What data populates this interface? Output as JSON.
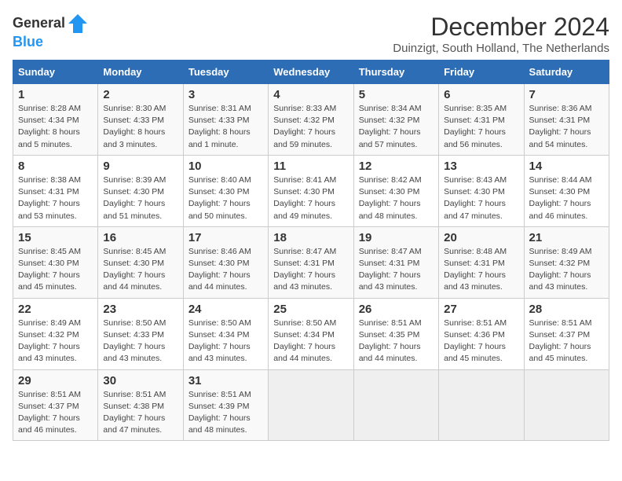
{
  "header": {
    "logo_general": "General",
    "logo_blue": "Blue",
    "main_title": "December 2024",
    "subtitle": "Duinzigt, South Holland, The Netherlands"
  },
  "days_of_week": [
    "Sunday",
    "Monday",
    "Tuesday",
    "Wednesday",
    "Thursday",
    "Friday",
    "Saturday"
  ],
  "weeks": [
    [
      {
        "day": "1",
        "sunrise": "Sunrise: 8:28 AM",
        "sunset": "Sunset: 4:34 PM",
        "daylight": "Daylight: 8 hours and 5 minutes."
      },
      {
        "day": "2",
        "sunrise": "Sunrise: 8:30 AM",
        "sunset": "Sunset: 4:33 PM",
        "daylight": "Daylight: 8 hours and 3 minutes."
      },
      {
        "day": "3",
        "sunrise": "Sunrise: 8:31 AM",
        "sunset": "Sunset: 4:33 PM",
        "daylight": "Daylight: 8 hours and 1 minute."
      },
      {
        "day": "4",
        "sunrise": "Sunrise: 8:33 AM",
        "sunset": "Sunset: 4:32 PM",
        "daylight": "Daylight: 7 hours and 59 minutes."
      },
      {
        "day": "5",
        "sunrise": "Sunrise: 8:34 AM",
        "sunset": "Sunset: 4:32 PM",
        "daylight": "Daylight: 7 hours and 57 minutes."
      },
      {
        "day": "6",
        "sunrise": "Sunrise: 8:35 AM",
        "sunset": "Sunset: 4:31 PM",
        "daylight": "Daylight: 7 hours and 56 minutes."
      },
      {
        "day": "7",
        "sunrise": "Sunrise: 8:36 AM",
        "sunset": "Sunset: 4:31 PM",
        "daylight": "Daylight: 7 hours and 54 minutes."
      }
    ],
    [
      {
        "day": "8",
        "sunrise": "Sunrise: 8:38 AM",
        "sunset": "Sunset: 4:31 PM",
        "daylight": "Daylight: 7 hours and 53 minutes."
      },
      {
        "day": "9",
        "sunrise": "Sunrise: 8:39 AM",
        "sunset": "Sunset: 4:30 PM",
        "daylight": "Daylight: 7 hours and 51 minutes."
      },
      {
        "day": "10",
        "sunrise": "Sunrise: 8:40 AM",
        "sunset": "Sunset: 4:30 PM",
        "daylight": "Daylight: 7 hours and 50 minutes."
      },
      {
        "day": "11",
        "sunrise": "Sunrise: 8:41 AM",
        "sunset": "Sunset: 4:30 PM",
        "daylight": "Daylight: 7 hours and 49 minutes."
      },
      {
        "day": "12",
        "sunrise": "Sunrise: 8:42 AM",
        "sunset": "Sunset: 4:30 PM",
        "daylight": "Daylight: 7 hours and 48 minutes."
      },
      {
        "day": "13",
        "sunrise": "Sunrise: 8:43 AM",
        "sunset": "Sunset: 4:30 PM",
        "daylight": "Daylight: 7 hours and 47 minutes."
      },
      {
        "day": "14",
        "sunrise": "Sunrise: 8:44 AM",
        "sunset": "Sunset: 4:30 PM",
        "daylight": "Daylight: 7 hours and 46 minutes."
      }
    ],
    [
      {
        "day": "15",
        "sunrise": "Sunrise: 8:45 AM",
        "sunset": "Sunset: 4:30 PM",
        "daylight": "Daylight: 7 hours and 45 minutes."
      },
      {
        "day": "16",
        "sunrise": "Sunrise: 8:45 AM",
        "sunset": "Sunset: 4:30 PM",
        "daylight": "Daylight: 7 hours and 44 minutes."
      },
      {
        "day": "17",
        "sunrise": "Sunrise: 8:46 AM",
        "sunset": "Sunset: 4:30 PM",
        "daylight": "Daylight: 7 hours and 44 minutes."
      },
      {
        "day": "18",
        "sunrise": "Sunrise: 8:47 AM",
        "sunset": "Sunset: 4:31 PM",
        "daylight": "Daylight: 7 hours and 43 minutes."
      },
      {
        "day": "19",
        "sunrise": "Sunrise: 8:47 AM",
        "sunset": "Sunset: 4:31 PM",
        "daylight": "Daylight: 7 hours and 43 minutes."
      },
      {
        "day": "20",
        "sunrise": "Sunrise: 8:48 AM",
        "sunset": "Sunset: 4:31 PM",
        "daylight": "Daylight: 7 hours and 43 minutes."
      },
      {
        "day": "21",
        "sunrise": "Sunrise: 8:49 AM",
        "sunset": "Sunset: 4:32 PM",
        "daylight": "Daylight: 7 hours and 43 minutes."
      }
    ],
    [
      {
        "day": "22",
        "sunrise": "Sunrise: 8:49 AM",
        "sunset": "Sunset: 4:32 PM",
        "daylight": "Daylight: 7 hours and 43 minutes."
      },
      {
        "day": "23",
        "sunrise": "Sunrise: 8:50 AM",
        "sunset": "Sunset: 4:33 PM",
        "daylight": "Daylight: 7 hours and 43 minutes."
      },
      {
        "day": "24",
        "sunrise": "Sunrise: 8:50 AM",
        "sunset": "Sunset: 4:34 PM",
        "daylight": "Daylight: 7 hours and 43 minutes."
      },
      {
        "day": "25",
        "sunrise": "Sunrise: 8:50 AM",
        "sunset": "Sunset: 4:34 PM",
        "daylight": "Daylight: 7 hours and 44 minutes."
      },
      {
        "day": "26",
        "sunrise": "Sunrise: 8:51 AM",
        "sunset": "Sunset: 4:35 PM",
        "daylight": "Daylight: 7 hours and 44 minutes."
      },
      {
        "day": "27",
        "sunrise": "Sunrise: 8:51 AM",
        "sunset": "Sunset: 4:36 PM",
        "daylight": "Daylight: 7 hours and 45 minutes."
      },
      {
        "day": "28",
        "sunrise": "Sunrise: 8:51 AM",
        "sunset": "Sunset: 4:37 PM",
        "daylight": "Daylight: 7 hours and 45 minutes."
      }
    ],
    [
      {
        "day": "29",
        "sunrise": "Sunrise: 8:51 AM",
        "sunset": "Sunset: 4:37 PM",
        "daylight": "Daylight: 7 hours and 46 minutes."
      },
      {
        "day": "30",
        "sunrise": "Sunrise: 8:51 AM",
        "sunset": "Sunset: 4:38 PM",
        "daylight": "Daylight: 7 hours and 47 minutes."
      },
      {
        "day": "31",
        "sunrise": "Sunrise: 8:51 AM",
        "sunset": "Sunset: 4:39 PM",
        "daylight": "Daylight: 7 hours and 48 minutes."
      },
      null,
      null,
      null,
      null
    ]
  ]
}
